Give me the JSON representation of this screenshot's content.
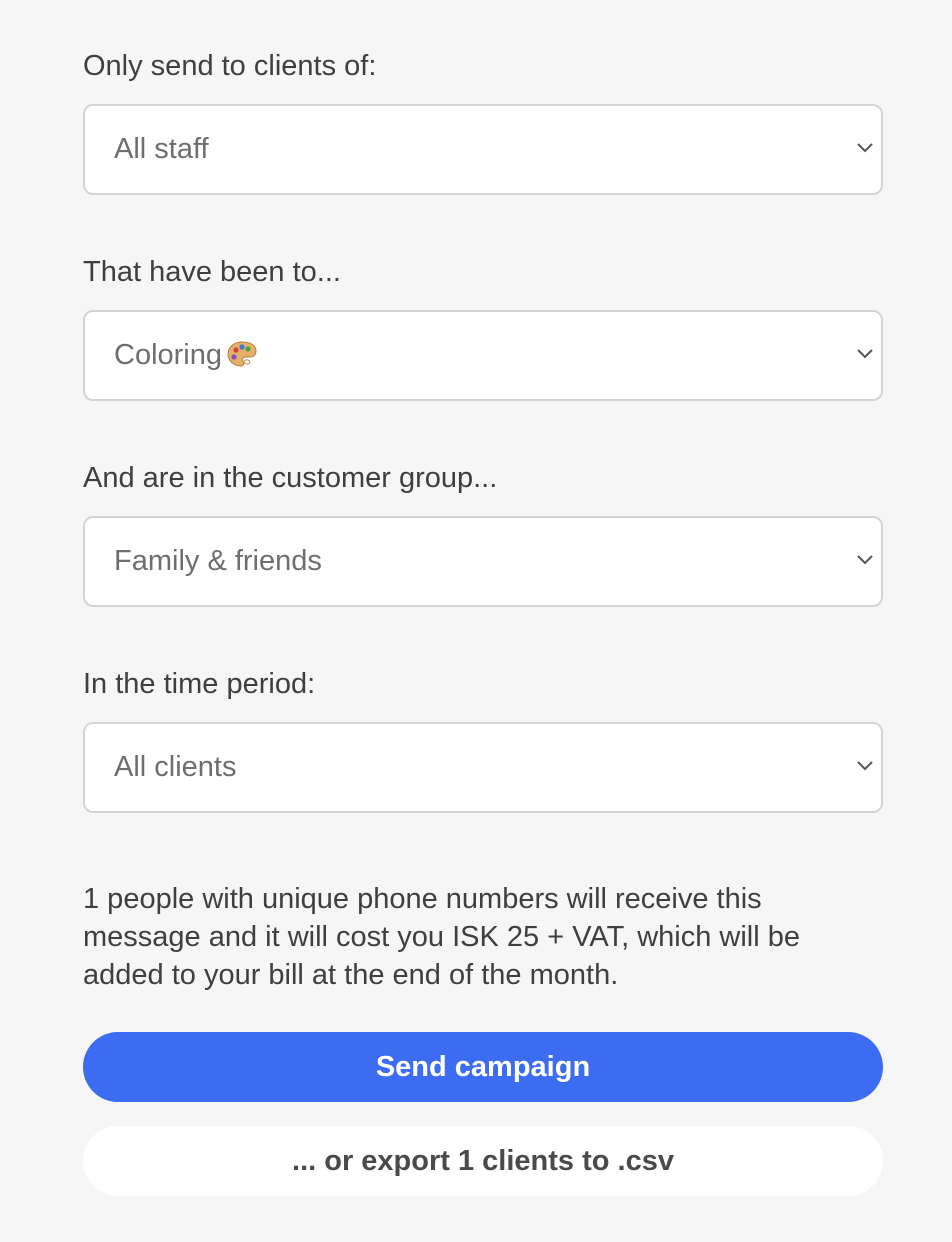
{
  "filters": [
    {
      "label": "Only send to clients of:",
      "value": "All staff"
    },
    {
      "label": "That have been to...",
      "value": "Coloring",
      "value_icon": "artist-palette-icon"
    },
    {
      "label": "And are in the customer group...",
      "value": "Family & friends"
    },
    {
      "label": "In the time period:",
      "value": "All clients"
    }
  ],
  "info": {
    "text": "1 people with unique phone numbers will receive this message and it will cost you ISK 25 + VAT, which will be added to your bill at the end of the month."
  },
  "actions": {
    "send_label": "Send campaign",
    "export_label": "... or export 1 clients to .csv"
  },
  "colors": {
    "background": "#f6f6f6",
    "primary": "#3b6cf2",
    "select_border": "#d4d4d4",
    "value_text": "#6e6e6e"
  }
}
